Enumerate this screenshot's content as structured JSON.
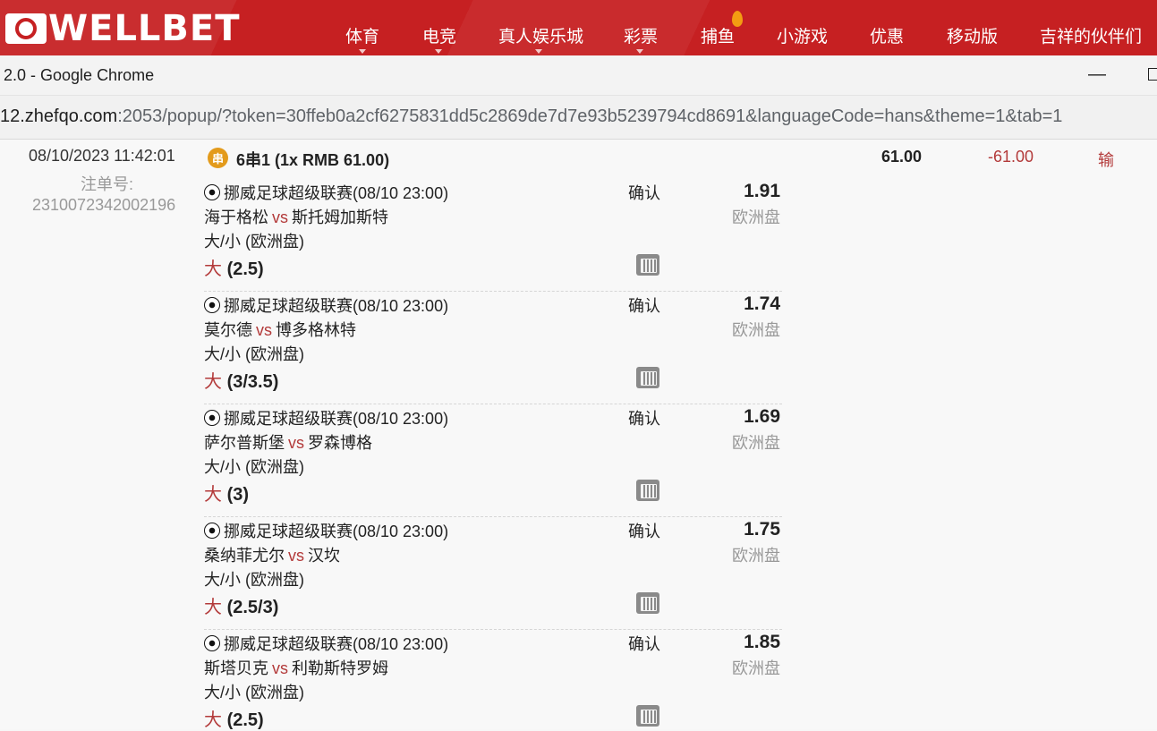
{
  "brand": {
    "logo_text": "WELLBET",
    "accent": "#c62022"
  },
  "nav": [
    {
      "label": "体育",
      "caret": true
    },
    {
      "label": "电竞",
      "caret": true
    },
    {
      "label": "真人娱乐城",
      "caret": true
    },
    {
      "label": "彩票",
      "caret": true
    },
    {
      "label": "捕鱼",
      "caret": false,
      "badge": "flame-icon"
    },
    {
      "label": "小游戏",
      "caret": false
    },
    {
      "label": "优惠",
      "caret": false
    },
    {
      "label": "移动版",
      "caret": false
    },
    {
      "label": "吉祥的伙伴们",
      "caret": false
    }
  ],
  "window": {
    "title": "2.0 - Google Chrome"
  },
  "address": {
    "host": "12.zhefqo.com",
    "rest": ":2053/popup/?token=30ffeb0a2cf6275831dd5c2869de7d7e93b5239794cd8691&languageCode=hans&theme=1&tab=1"
  },
  "bet": {
    "datetime": "08/10/2023 11:42:01",
    "ticket_label": "注单号:",
    "ticket_no": "2310072342002196",
    "parlay_badge": "串",
    "parlay_title": "6串1 (1x RMB 61.00)",
    "stake": "61.00",
    "winloss": "-61.00",
    "result": "输",
    "legs": [
      {
        "league": "挪威足球超级联赛(08/10 23:00)",
        "home": "海于格松",
        "vs": "vs",
        "away": "斯托姆加斯特",
        "market": "大/小 (欧洲盘)",
        "sel_word": "大",
        "sel_line": "(2.5)",
        "status": "确认",
        "odds": "1.91",
        "odds_type": "欧洲盘"
      },
      {
        "league": "挪威足球超级联赛(08/10 23:00)",
        "home": "莫尔德",
        "vs": "vs",
        "away": "博多格林特",
        "market": "大/小 (欧洲盘)",
        "sel_word": "大",
        "sel_line": "(3/3.5)",
        "status": "确认",
        "odds": "1.74",
        "odds_type": "欧洲盘"
      },
      {
        "league": "挪威足球超级联赛(08/10 23:00)",
        "home": "萨尔普斯堡",
        "vs": "vs",
        "away": "罗森博格",
        "market": "大/小 (欧洲盘)",
        "sel_word": "大",
        "sel_line": "(3)",
        "status": "确认",
        "odds": "1.69",
        "odds_type": "欧洲盘"
      },
      {
        "league": "挪威足球超级联赛(08/10 23:00)",
        "home": "桑纳菲尤尔",
        "vs": "vs",
        "away": "汉坎",
        "market": "大/小 (欧洲盘)",
        "sel_word": "大",
        "sel_line": "(2.5/3)",
        "status": "确认",
        "odds": "1.75",
        "odds_type": "欧洲盘"
      },
      {
        "league": "挪威足球超级联赛(08/10 23:00)",
        "home": "斯塔贝克",
        "vs": "vs",
        "away": "利勒斯特罗姆",
        "market": "大/小 (欧洲盘)",
        "sel_word": "大",
        "sel_line": "(2.5)",
        "status": "确认",
        "odds": "1.85",
        "odds_type": "欧洲盘"
      }
    ]
  }
}
